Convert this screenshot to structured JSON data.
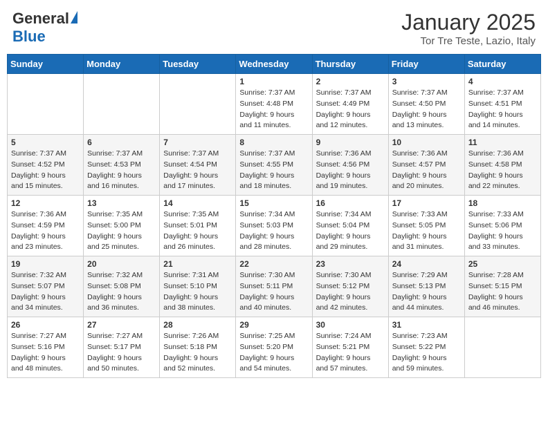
{
  "header": {
    "logo_general": "General",
    "logo_blue": "Blue",
    "month_title": "January 2025",
    "location": "Tor Tre Teste, Lazio, Italy"
  },
  "weekdays": [
    "Sunday",
    "Monday",
    "Tuesday",
    "Wednesday",
    "Thursday",
    "Friday",
    "Saturday"
  ],
  "weeks": [
    [
      {
        "day": "",
        "sunrise": "",
        "sunset": "",
        "daylight": ""
      },
      {
        "day": "",
        "sunrise": "",
        "sunset": "",
        "daylight": ""
      },
      {
        "day": "",
        "sunrise": "",
        "sunset": "",
        "daylight": ""
      },
      {
        "day": "1",
        "sunrise": "Sunrise: 7:37 AM",
        "sunset": "Sunset: 4:48 PM",
        "daylight": "Daylight: 9 hours and 11 minutes."
      },
      {
        "day": "2",
        "sunrise": "Sunrise: 7:37 AM",
        "sunset": "Sunset: 4:49 PM",
        "daylight": "Daylight: 9 hours and 12 minutes."
      },
      {
        "day": "3",
        "sunrise": "Sunrise: 7:37 AM",
        "sunset": "Sunset: 4:50 PM",
        "daylight": "Daylight: 9 hours and 13 minutes."
      },
      {
        "day": "4",
        "sunrise": "Sunrise: 7:37 AM",
        "sunset": "Sunset: 4:51 PM",
        "daylight": "Daylight: 9 hours and 14 minutes."
      }
    ],
    [
      {
        "day": "5",
        "sunrise": "Sunrise: 7:37 AM",
        "sunset": "Sunset: 4:52 PM",
        "daylight": "Daylight: 9 hours and 15 minutes."
      },
      {
        "day": "6",
        "sunrise": "Sunrise: 7:37 AM",
        "sunset": "Sunset: 4:53 PM",
        "daylight": "Daylight: 9 hours and 16 minutes."
      },
      {
        "day": "7",
        "sunrise": "Sunrise: 7:37 AM",
        "sunset": "Sunset: 4:54 PM",
        "daylight": "Daylight: 9 hours and 17 minutes."
      },
      {
        "day": "8",
        "sunrise": "Sunrise: 7:37 AM",
        "sunset": "Sunset: 4:55 PM",
        "daylight": "Daylight: 9 hours and 18 minutes."
      },
      {
        "day": "9",
        "sunrise": "Sunrise: 7:36 AM",
        "sunset": "Sunset: 4:56 PM",
        "daylight": "Daylight: 9 hours and 19 minutes."
      },
      {
        "day": "10",
        "sunrise": "Sunrise: 7:36 AM",
        "sunset": "Sunset: 4:57 PM",
        "daylight": "Daylight: 9 hours and 20 minutes."
      },
      {
        "day": "11",
        "sunrise": "Sunrise: 7:36 AM",
        "sunset": "Sunset: 4:58 PM",
        "daylight": "Daylight: 9 hours and 22 minutes."
      }
    ],
    [
      {
        "day": "12",
        "sunrise": "Sunrise: 7:36 AM",
        "sunset": "Sunset: 4:59 PM",
        "daylight": "Daylight: 9 hours and 23 minutes."
      },
      {
        "day": "13",
        "sunrise": "Sunrise: 7:35 AM",
        "sunset": "Sunset: 5:00 PM",
        "daylight": "Daylight: 9 hours and 25 minutes."
      },
      {
        "day": "14",
        "sunrise": "Sunrise: 7:35 AM",
        "sunset": "Sunset: 5:01 PM",
        "daylight": "Daylight: 9 hours and 26 minutes."
      },
      {
        "day": "15",
        "sunrise": "Sunrise: 7:34 AM",
        "sunset": "Sunset: 5:03 PM",
        "daylight": "Daylight: 9 hours and 28 minutes."
      },
      {
        "day": "16",
        "sunrise": "Sunrise: 7:34 AM",
        "sunset": "Sunset: 5:04 PM",
        "daylight": "Daylight: 9 hours and 29 minutes."
      },
      {
        "day": "17",
        "sunrise": "Sunrise: 7:33 AM",
        "sunset": "Sunset: 5:05 PM",
        "daylight": "Daylight: 9 hours and 31 minutes."
      },
      {
        "day": "18",
        "sunrise": "Sunrise: 7:33 AM",
        "sunset": "Sunset: 5:06 PM",
        "daylight": "Daylight: 9 hours and 33 minutes."
      }
    ],
    [
      {
        "day": "19",
        "sunrise": "Sunrise: 7:32 AM",
        "sunset": "Sunset: 5:07 PM",
        "daylight": "Daylight: 9 hours and 34 minutes."
      },
      {
        "day": "20",
        "sunrise": "Sunrise: 7:32 AM",
        "sunset": "Sunset: 5:08 PM",
        "daylight": "Daylight: 9 hours and 36 minutes."
      },
      {
        "day": "21",
        "sunrise": "Sunrise: 7:31 AM",
        "sunset": "Sunset: 5:10 PM",
        "daylight": "Daylight: 9 hours and 38 minutes."
      },
      {
        "day": "22",
        "sunrise": "Sunrise: 7:30 AM",
        "sunset": "Sunset: 5:11 PM",
        "daylight": "Daylight: 9 hours and 40 minutes."
      },
      {
        "day": "23",
        "sunrise": "Sunrise: 7:30 AM",
        "sunset": "Sunset: 5:12 PM",
        "daylight": "Daylight: 9 hours and 42 minutes."
      },
      {
        "day": "24",
        "sunrise": "Sunrise: 7:29 AM",
        "sunset": "Sunset: 5:13 PM",
        "daylight": "Daylight: 9 hours and 44 minutes."
      },
      {
        "day": "25",
        "sunrise": "Sunrise: 7:28 AM",
        "sunset": "Sunset: 5:15 PM",
        "daylight": "Daylight: 9 hours and 46 minutes."
      }
    ],
    [
      {
        "day": "26",
        "sunrise": "Sunrise: 7:27 AM",
        "sunset": "Sunset: 5:16 PM",
        "daylight": "Daylight: 9 hours and 48 minutes."
      },
      {
        "day": "27",
        "sunrise": "Sunrise: 7:27 AM",
        "sunset": "Sunset: 5:17 PM",
        "daylight": "Daylight: 9 hours and 50 minutes."
      },
      {
        "day": "28",
        "sunrise": "Sunrise: 7:26 AM",
        "sunset": "Sunset: 5:18 PM",
        "daylight": "Daylight: 9 hours and 52 minutes."
      },
      {
        "day": "29",
        "sunrise": "Sunrise: 7:25 AM",
        "sunset": "Sunset: 5:20 PM",
        "daylight": "Daylight: 9 hours and 54 minutes."
      },
      {
        "day": "30",
        "sunrise": "Sunrise: 7:24 AM",
        "sunset": "Sunset: 5:21 PM",
        "daylight": "Daylight: 9 hours and 57 minutes."
      },
      {
        "day": "31",
        "sunrise": "Sunrise: 7:23 AM",
        "sunset": "Sunset: 5:22 PM",
        "daylight": "Daylight: 9 hours and 59 minutes."
      },
      {
        "day": "",
        "sunrise": "",
        "sunset": "",
        "daylight": ""
      }
    ]
  ]
}
